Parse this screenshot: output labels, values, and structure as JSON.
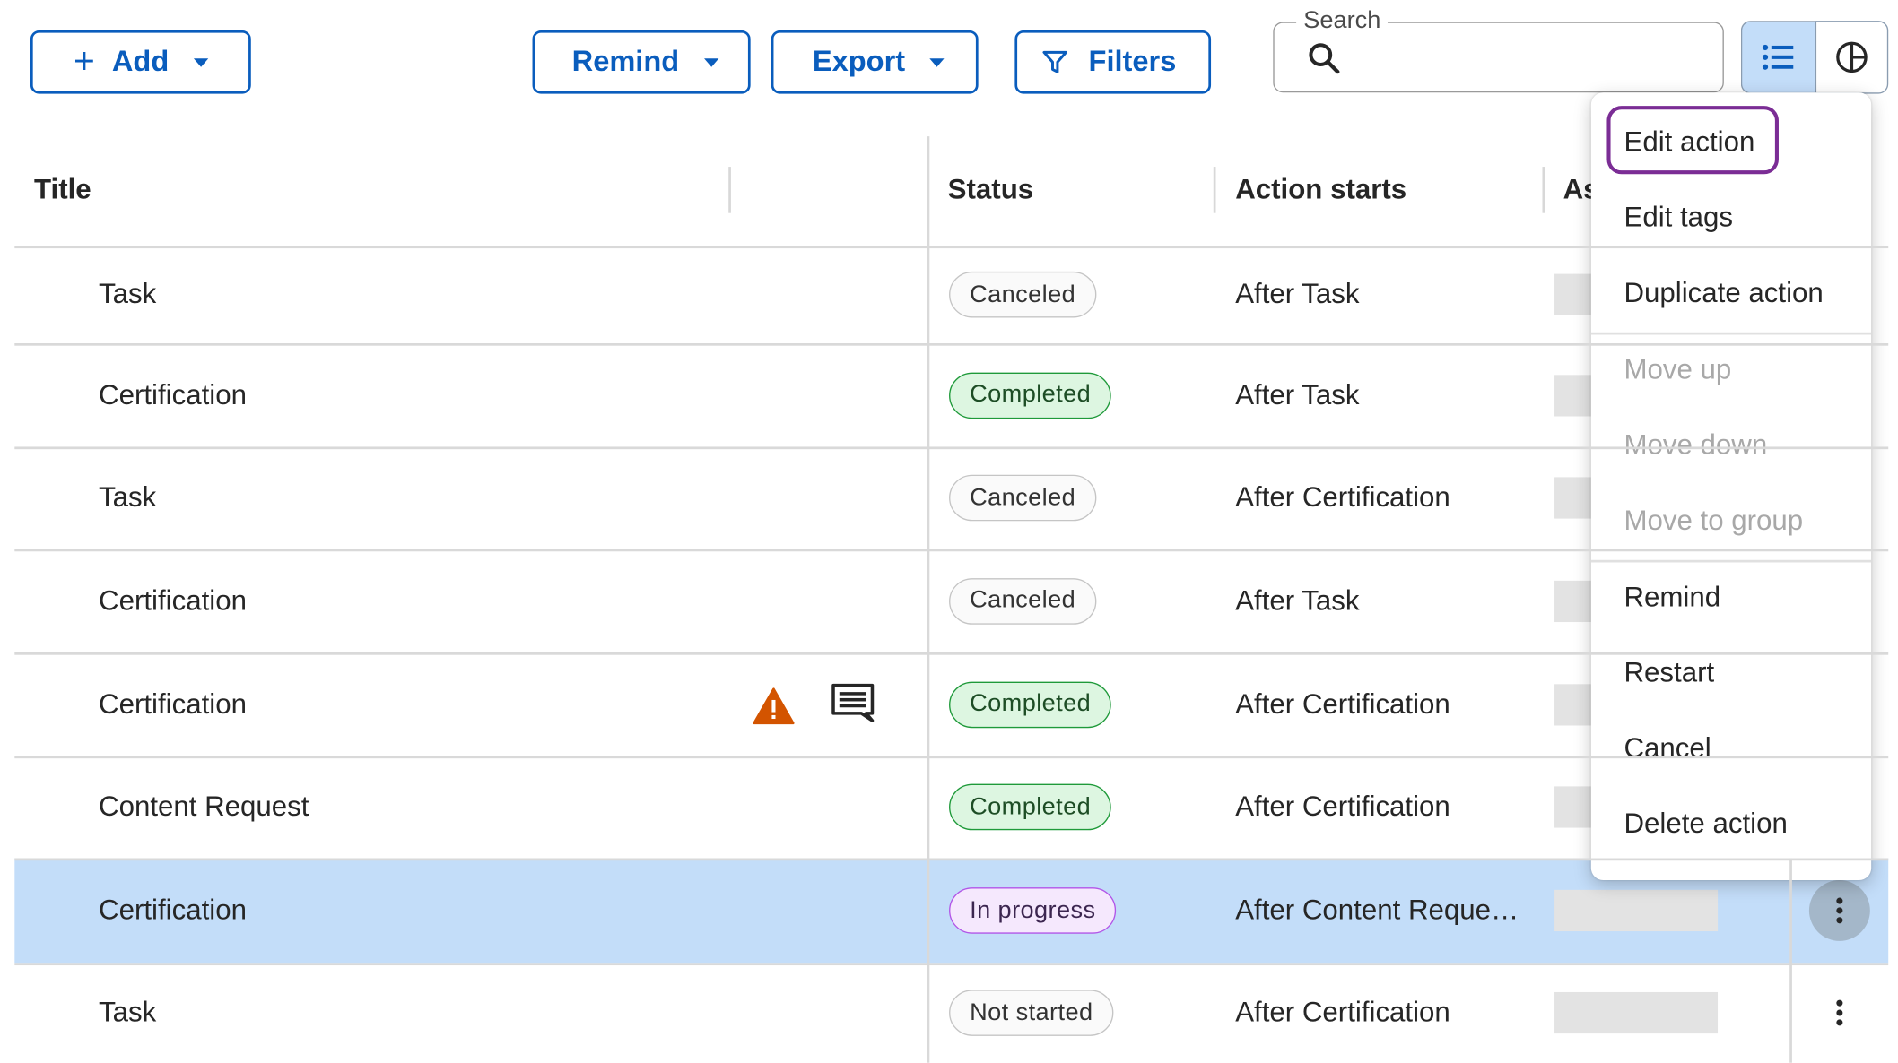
{
  "toolbar": {
    "add_label": "Add",
    "remind_label": "Remind",
    "export_label": "Export",
    "filters_label": "Filters",
    "search_label": "Search",
    "search_value": ""
  },
  "columns": {
    "title": "Title",
    "status": "Status",
    "action_starts": "Action starts",
    "assignee_partial": "As"
  },
  "rows": [
    {
      "title": "Task",
      "status": "Canceled",
      "status_color": "gray",
      "action_starts": "After Task"
    },
    {
      "title": "Certification",
      "status": "Completed",
      "status_color": "green",
      "action_starts": "After Task"
    },
    {
      "title": "Task",
      "status": "Canceled",
      "status_color": "gray",
      "action_starts": "After Certification"
    },
    {
      "title": "Certification",
      "status": "Canceled",
      "status_color": "gray",
      "action_starts": "After Task"
    },
    {
      "title": "Certification",
      "status": "Completed",
      "status_color": "green",
      "action_starts": "After Certification",
      "icons": [
        "warning-icon",
        "comment-icon"
      ]
    },
    {
      "title": "Content Request",
      "status": "Completed",
      "status_color": "green",
      "action_starts": "After Certification"
    },
    {
      "title": "Certification",
      "status": "In progress",
      "status_color": "purple",
      "action_starts": "After Content Reque…",
      "selected": true
    },
    {
      "title": "Task",
      "status": "Not started",
      "status_color": "gray",
      "action_starts": "After Certification"
    }
  ],
  "menu": {
    "items": [
      {
        "label": "Edit action",
        "enabled": true,
        "focused": true
      },
      {
        "label": "Edit tags",
        "enabled": true
      },
      {
        "label": "Duplicate action",
        "enabled": true
      },
      {
        "label": "Move up",
        "enabled": false
      },
      {
        "label": "Move down",
        "enabled": false
      },
      {
        "label": "Move to group",
        "enabled": false
      },
      {
        "label": "Remind",
        "enabled": true
      },
      {
        "label": "Restart",
        "enabled": true
      },
      {
        "label": "Cancel",
        "enabled": true
      },
      {
        "label": "Delete action",
        "enabled": true
      }
    ]
  },
  "colors": {
    "primary": "#0a5dbd",
    "selected_row": "#c3ddf9",
    "warning": "#d35400",
    "focus_ring": "#7b2d95"
  }
}
